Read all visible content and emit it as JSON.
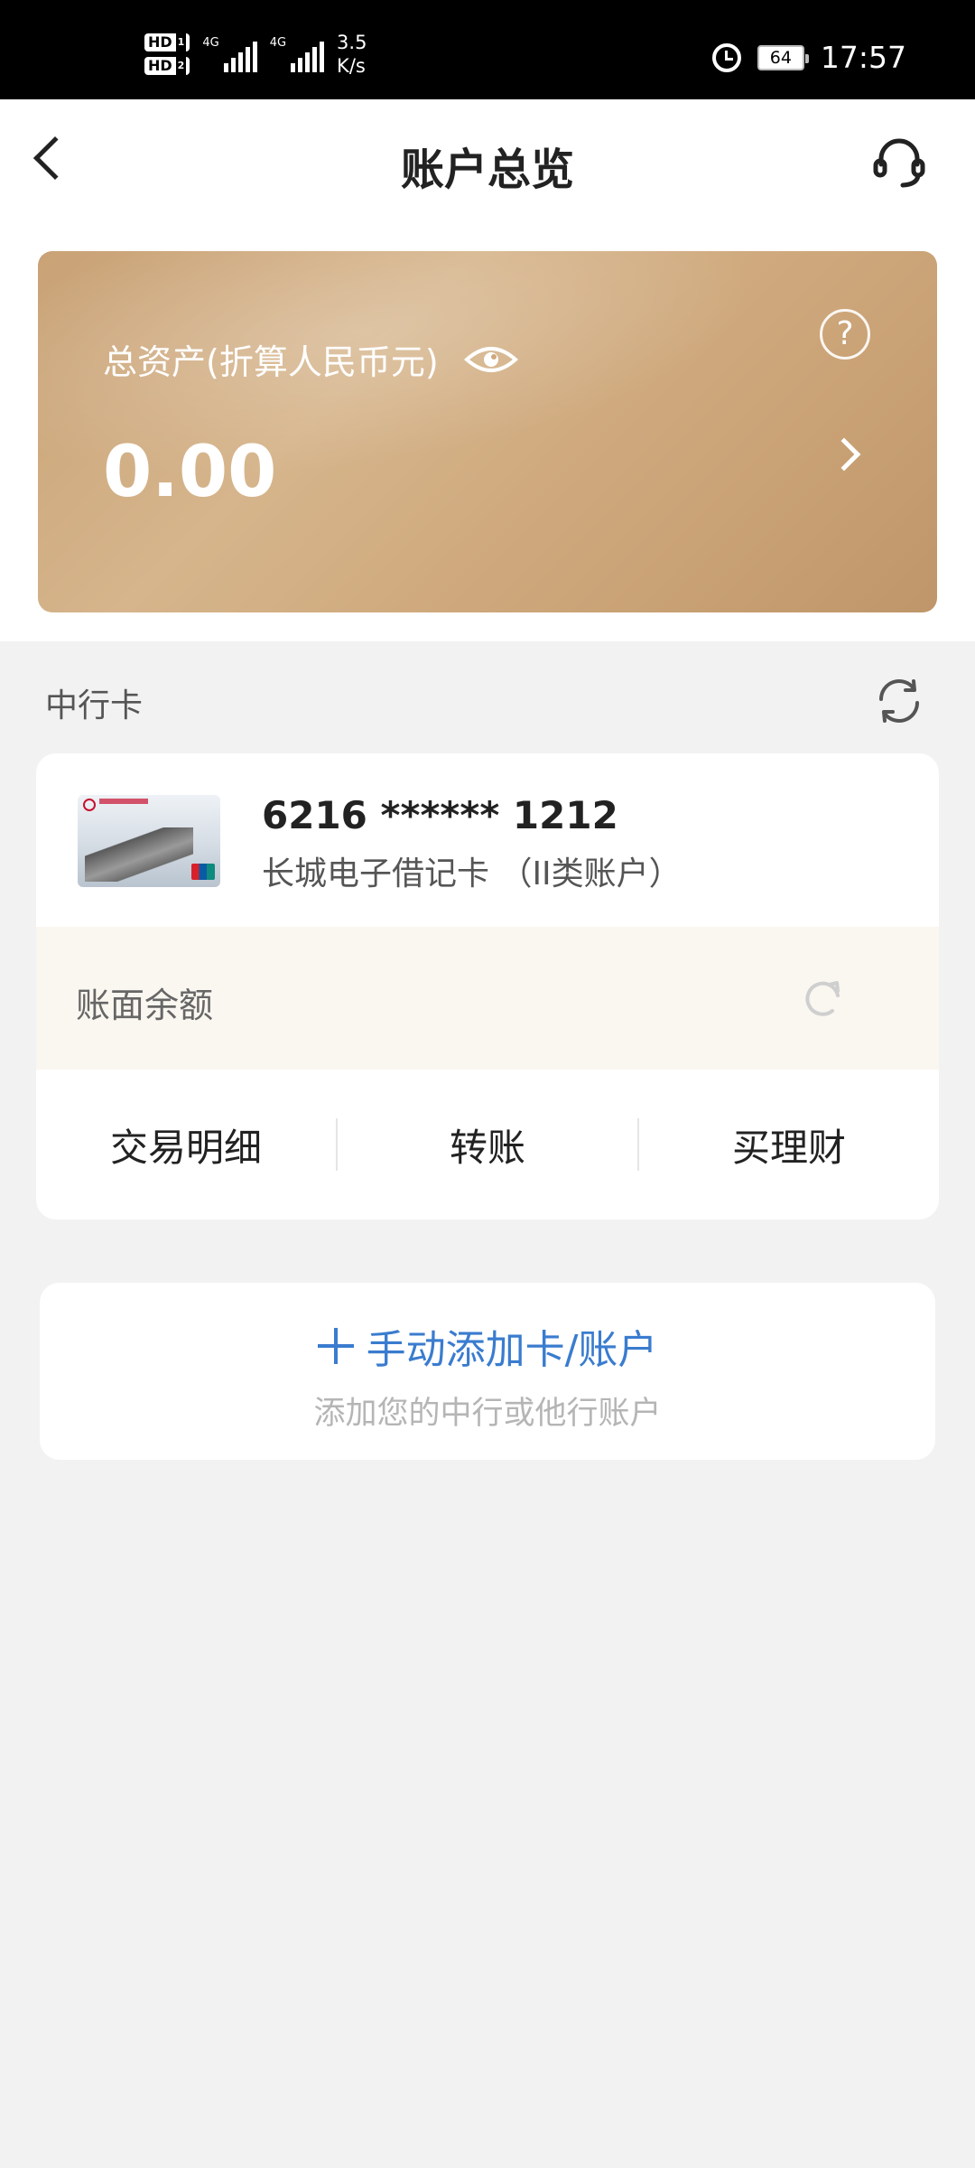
{
  "status_bar": {
    "hd1": "HD",
    "hd1_sim": "1",
    "hd2": "HD",
    "hd2_sim": "2",
    "net1": "4G",
    "net2": "4G",
    "speed_value": "3.5",
    "speed_unit": "K/s",
    "battery": "64",
    "time": "17:57"
  },
  "header": {
    "title": "账户总览"
  },
  "asset_card": {
    "label": "总资产(折算人民币元)",
    "amount": "0.00",
    "help": "?"
  },
  "section": {
    "title": "中行卡"
  },
  "account": {
    "card_number": "6216 ****** 1212",
    "card_type": "长城电子借记卡 （II类账户）",
    "balance_label": "账面余额",
    "actions": [
      "交易明细",
      "转账",
      "买理财"
    ]
  },
  "add_card": {
    "title": "手动添加卡/账户",
    "subtitle": "添加您的中行或他行账户"
  },
  "colors": {
    "accent_blue": "#3a7ccf",
    "gold": "#cfa97d"
  }
}
